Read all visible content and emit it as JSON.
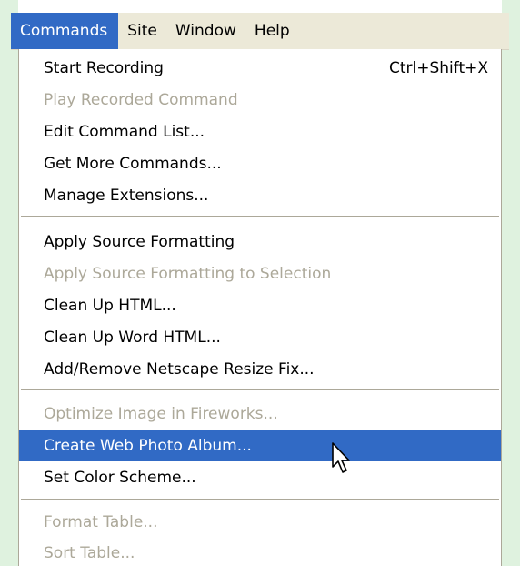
{
  "menubar": {
    "items": [
      "Commands",
      "Site",
      "Window",
      "Help"
    ],
    "active_index": 0
  },
  "menu": {
    "groups": [
      [
        {
          "label": "Start Recording",
          "shortcut": "Ctrl+Shift+X",
          "enabled": true
        },
        {
          "label": "Play Recorded Command",
          "enabled": false
        },
        {
          "label": "Edit Command List...",
          "enabled": true
        },
        {
          "label": "Get More Commands...",
          "enabled": true
        },
        {
          "label": "Manage Extensions...",
          "enabled": true
        }
      ],
      [
        {
          "label": "Apply Source Formatting",
          "enabled": true
        },
        {
          "label": "Apply Source Formatting to Selection",
          "enabled": false
        },
        {
          "label": "Clean Up HTML...",
          "enabled": true
        },
        {
          "label": "Clean Up Word HTML...",
          "enabled": true
        },
        {
          "label": "Add/Remove Netscape Resize Fix...",
          "enabled": true
        }
      ],
      [
        {
          "label": "Optimize Image in Fireworks...",
          "enabled": false
        },
        {
          "label": "Create Web Photo Album...",
          "enabled": true,
          "highlighted": true
        },
        {
          "label": "Set Color Scheme...",
          "enabled": true
        }
      ],
      [
        {
          "label": "Format Table...",
          "enabled": false
        },
        {
          "label": "Sort Table...",
          "enabled": false
        }
      ]
    ]
  },
  "colors": {
    "highlight": "#316ac5",
    "disabled_text": "#aca899",
    "menubar_bg": "#ece9d8",
    "side_bg": "#dff2df"
  },
  "cursor_icon": "arrow-pointer-icon"
}
